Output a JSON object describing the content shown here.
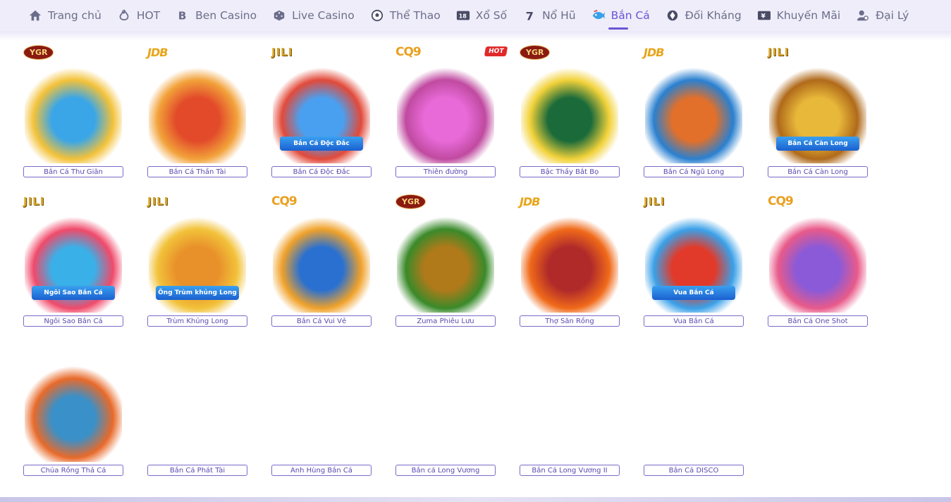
{
  "nav": {
    "items": [
      {
        "label": "Trang chủ",
        "icon": "home-icon"
      },
      {
        "label": "HOT",
        "icon": "flame-icon"
      },
      {
        "label": "Ben Casino",
        "icon": "b-icon"
      },
      {
        "label": "Live Casino",
        "icon": "dice-icon"
      },
      {
        "label": "Thể Thao",
        "icon": "soccer-ball-icon"
      },
      {
        "label": "Xổ Số",
        "icon": "lottery-icon"
      },
      {
        "label": "Nổ Hũ",
        "icon": "seven-icon"
      },
      {
        "label": "Bắn Cá",
        "icon": "fish-icon"
      },
      {
        "label": "Đối Kháng",
        "icon": "versus-icon"
      },
      {
        "label": "Khuyến Mãi",
        "icon": "gift-ticket-icon"
      },
      {
        "label": "Đại Lý",
        "icon": "agent-icon"
      }
    ],
    "active_label": "Bắn Cá"
  },
  "games": [
    {
      "name": "Bắn Cá Thư Giãn",
      "provider": "YGR",
      "hot": false,
      "colors": [
        "#3aa6e8",
        "#f3c23a"
      ]
    },
    {
      "name": "Bắn Cá Thần Tài",
      "provider": "JDB",
      "hot": false,
      "colors": [
        "#e24a2a",
        "#f2a23a"
      ]
    },
    {
      "name": "Bắn Cá Độc Đắc",
      "provider": "JILI",
      "hot": false,
      "colors": [
        "#4aa0f0",
        "#e24a3a"
      ],
      "banner": "Bắn Cá Độc Đắc"
    },
    {
      "name": "Thiên đường",
      "provider": "CQ9",
      "hot": true,
      "hot_label": "HOT",
      "colors": [
        "#e86ad8",
        "#c04aa0"
      ]
    },
    {
      "name": "Bậc Thầy Bắt Bọ",
      "provider": "YGR",
      "hot": false,
      "colors": [
        "#1a6a3a",
        "#f2d23a"
      ]
    },
    {
      "name": "Bắn Cá Ngũ Long",
      "provider": "JDB",
      "hot": false,
      "colors": [
        "#e2702a",
        "#2a80d0"
      ]
    },
    {
      "name": "Bắn Cá Càn Long",
      "provider": "JILI",
      "hot": false,
      "colors": [
        "#e8b83a",
        "#b06a1a"
      ],
      "banner": "Bắn Cá Càn Long"
    },
    {
      "name": "Ngôi Sao Bắn Cá",
      "provider": "JILI",
      "hot": false,
      "colors": [
        "#3ab0e8",
        "#f04a6a"
      ],
      "banner": "Ngôi Sao Bắn Cá"
    },
    {
      "name": "Trùm Khủng Long",
      "provider": "JILI",
      "hot": false,
      "colors": [
        "#e8902a",
        "#f2c23a"
      ],
      "banner": "Ông Trùm khủng Long"
    },
    {
      "name": "Bắn Cá Vui Vẻ",
      "provider": "CQ9",
      "hot": false,
      "colors": [
        "#2a70d0",
        "#f0a22a"
      ]
    },
    {
      "name": "Zuma Phiêu Lưu",
      "provider": "YGR",
      "hot": false,
      "colors": [
        "#b07a1a",
        "#3a8a2a"
      ]
    },
    {
      "name": "Thợ Săn Rồng",
      "provider": "JDB",
      "hot": false,
      "colors": [
        "#b02a2a",
        "#f06a1a"
      ]
    },
    {
      "name": "Vua Bắn Cá",
      "provider": "JILI",
      "hot": false,
      "colors": [
        "#e23a2a",
        "#3aa0e8"
      ],
      "banner": "Vua Bắn Cá"
    },
    {
      "name": "Bắn Cá One Shot",
      "provider": "CQ9",
      "hot": false,
      "colors": [
        "#8a5ad8",
        "#e85a8a"
      ]
    },
    {
      "name": "Chúa Rồng Thả Cá",
      "provider": "",
      "hot": false,
      "colors": [
        "#3a90c8",
        "#e86a2a"
      ]
    },
    {
      "name": "Bắn Cá Phát Tài",
      "provider": "",
      "hot": false,
      "colors": []
    },
    {
      "name": "Anh Hùng Bắn Cá",
      "provider": "",
      "hot": false,
      "colors": []
    },
    {
      "name": "Bắn cá Long Vương",
      "provider": "",
      "hot": false,
      "colors": []
    },
    {
      "name": "Bắn Cá Long Vương II",
      "provider": "",
      "hot": false,
      "colors": []
    },
    {
      "name": "Bắn Cá DISCO",
      "provider": "",
      "hot": false,
      "colors": []
    }
  ]
}
